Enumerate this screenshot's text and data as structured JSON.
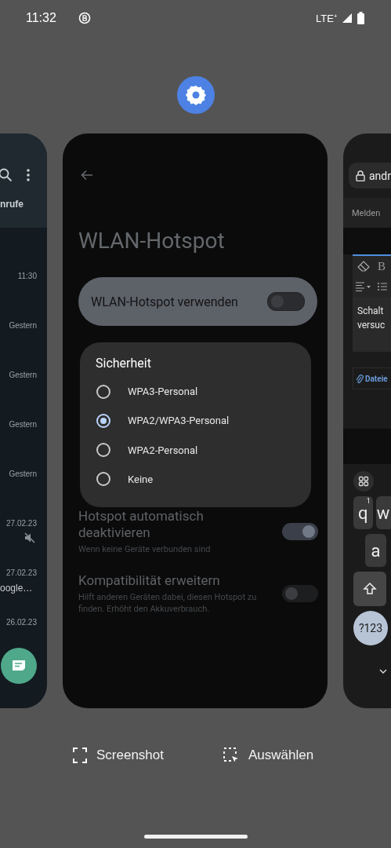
{
  "status_bar": {
    "time": "11:32",
    "network": "LTE⁺"
  },
  "left_app": {
    "tab_fragment": "nrufe",
    "entries": [
      {
        "time": "11:30",
        "muted": false
      },
      {
        "time": "Gestern",
        "muted": false
      },
      {
        "time": "Gestern",
        "muted": false
      },
      {
        "time": "Gestern",
        "muted": false
      },
      {
        "time": "Gestern",
        "muted": false
      },
      {
        "time": "27.02.23",
        "muted": true
      },
      {
        "time": "27.02.23",
        "muted": false,
        "snippet": "oogle…"
      },
      {
        "time": "26.02.23",
        "muted": false
      }
    ]
  },
  "center_app": {
    "title": "WLAN-Hotspot",
    "main_switch": {
      "label": "WLAN-Hotspot verwenden",
      "on": false
    },
    "settings": [
      {
        "title": "Hotspot automatisch deaktivieren",
        "subtitle": "Wenn keine Geräte verbunden sind",
        "on": true
      },
      {
        "title": "Kompatibilität erweitern",
        "subtitle": "Hilft anderen Geräten dabei, diesen Hotspot zu finden. Erhöht den Akkuverbrauch.",
        "on": false
      }
    ],
    "dialog": {
      "title": "Sicherheit",
      "options": [
        {
          "label": "WPA3-Personal",
          "selected": false
        },
        {
          "label": "WPA2/WPA3-Personal",
          "selected": true
        },
        {
          "label": "WPA2-Personal",
          "selected": false
        },
        {
          "label": "Keine",
          "selected": false
        }
      ]
    }
  },
  "right_app": {
    "url_fragment": "andr",
    "tab_fragment": "Melden",
    "bold_button": "B",
    "text_lines": [
      "Schalt",
      "versuc"
    ],
    "attach_fragment": "Dateie",
    "keyboard": {
      "q": "q",
      "q_hint": "1",
      "w": "w",
      "a": "a",
      "symbols": "?123"
    }
  },
  "actions": [
    {
      "label": "Screenshot",
      "kind": "screenshot"
    },
    {
      "label": "Auswählen",
      "kind": "select"
    }
  ]
}
